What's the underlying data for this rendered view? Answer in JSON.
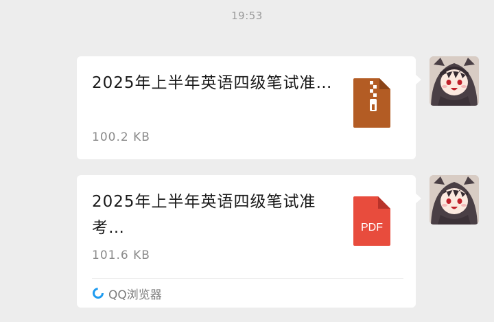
{
  "chat": {
    "timestamp": "19:53",
    "messages": [
      {
        "file_name": "2025年上半年英语四级笔试准…",
        "file_size": "100.2 KB",
        "file_type_icon": "zip-file-icon",
        "avatar_icon": "avatar-anime-girl-icon"
      },
      {
        "file_name": "2025年上半年英语四级笔试准考…",
        "file_size": "101.6 KB",
        "file_type_icon": "pdf-file-icon",
        "file_type_label": "PDF",
        "source_app_label": "QQ浏览器",
        "source_app_icon": "qq-browser-icon",
        "avatar_icon": "avatar-anime-girl-icon"
      }
    ]
  },
  "colors": {
    "background": "#ededed",
    "bubble": "#ffffff",
    "zip_icon": "#b35c24",
    "pdf_icon": "#e84c3d",
    "qq_browser_accent": "#1e9bf0"
  }
}
